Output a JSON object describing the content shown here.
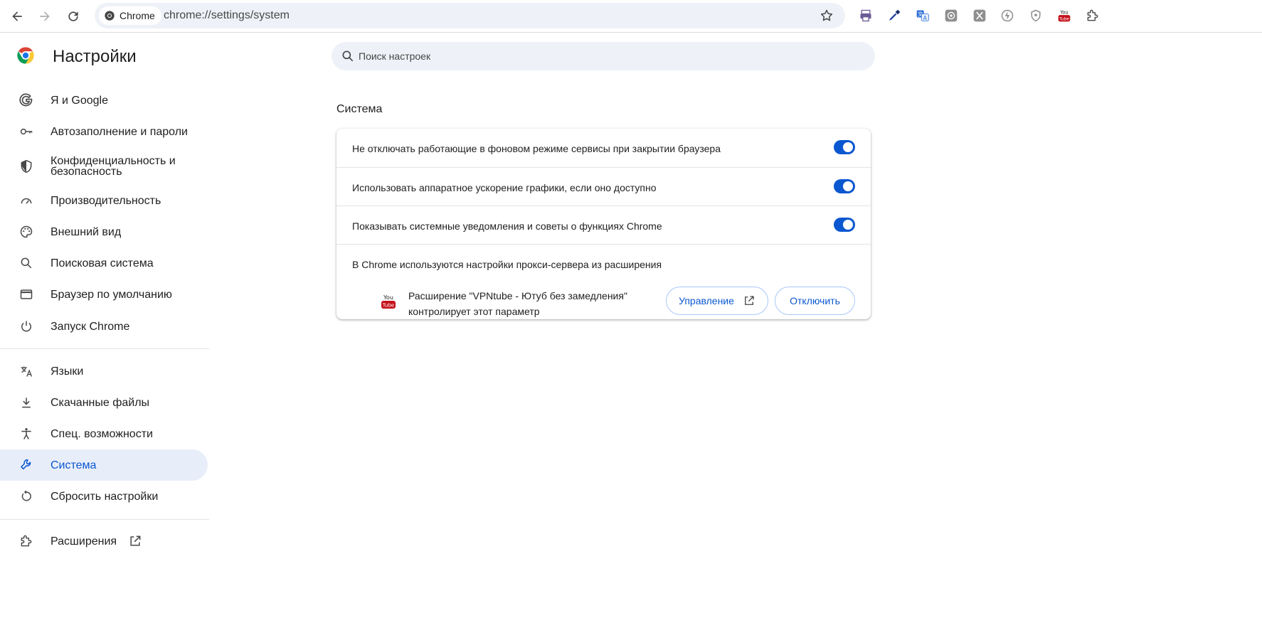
{
  "toolbar": {
    "chip_label": "Chrome",
    "url": "chrome://settings/system"
  },
  "brand": {
    "title": "Настройки"
  },
  "sidebar": {
    "items": [
      {
        "label": "Я и Google",
        "icon": "google-icon"
      },
      {
        "label": "Автозаполнение и пароли",
        "icon": "key-icon"
      },
      {
        "label": "Конфиденциальность и безопасность",
        "icon": "shield-icon"
      },
      {
        "label": "Производительность",
        "icon": "speedometer-icon"
      },
      {
        "label": "Внешний вид",
        "icon": "palette-icon"
      },
      {
        "label": "Поисковая система",
        "icon": "search-icon"
      },
      {
        "label": "Браузер по умолчанию",
        "icon": "browser-window-icon"
      },
      {
        "label": "Запуск Chrome",
        "icon": "power-icon"
      },
      {
        "label": "Языки",
        "icon": "translate-icon"
      },
      {
        "label": "Скачанные файлы",
        "icon": "download-icon"
      },
      {
        "label": "Спец. возможности",
        "icon": "accessibility-icon"
      },
      {
        "label": "Система",
        "icon": "wrench-icon"
      },
      {
        "label": "Сбросить настройки",
        "icon": "reset-icon"
      },
      {
        "label": "Расширения",
        "icon": "puzzle-icon"
      }
    ]
  },
  "search": {
    "placeholder": "Поиск настроек"
  },
  "section": {
    "title": "Система",
    "rows": [
      {
        "label": "Не отключать работающие в фоновом режиме сервисы при закрытии браузера",
        "enabled": true
      },
      {
        "label": "Использовать аппаратное ускорение графики, если оно доступно",
        "enabled": true
      },
      {
        "label": "Показывать системные уведомления и советы о функциях Chrome",
        "enabled": true
      }
    ],
    "proxy_label": "В Chrome используются настройки прокси-сервера из расширения",
    "extension_line1": "Расширение \"VPNtube - Ютуб без замедления\"",
    "extension_line2": "контролирует этот параметр",
    "extension_logo_text": "You Tube",
    "manage_label": "Управление",
    "disable_label": "Отключить"
  },
  "colors": {
    "accent": "#0b57d0",
    "active_bg": "#e8eef9",
    "search_bg": "#eef2f8"
  }
}
